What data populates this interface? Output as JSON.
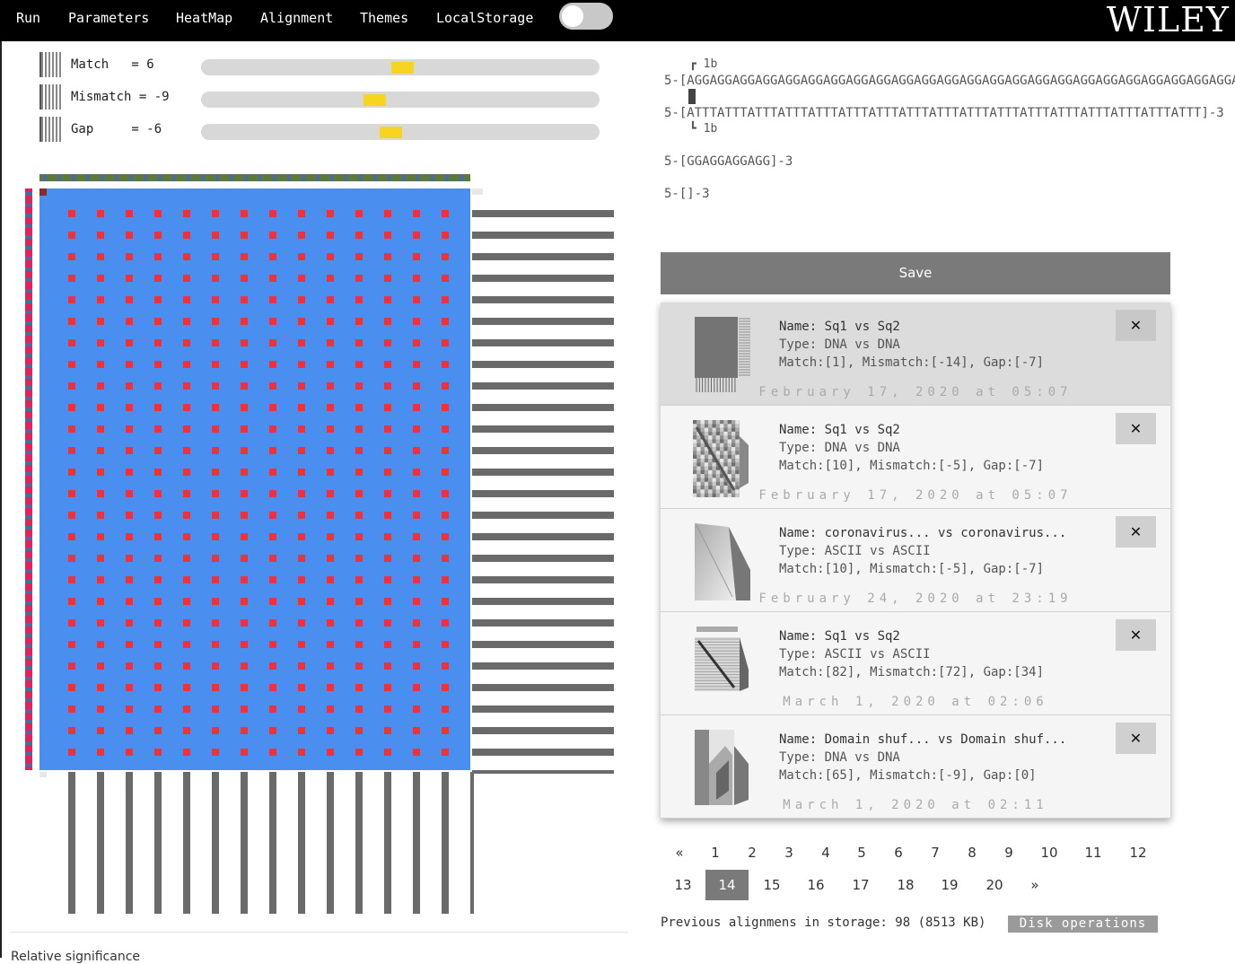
{
  "nav": {
    "items": [
      "Run",
      "Parameters",
      "HeatMap",
      "Alignment",
      "Themes",
      "LocalStorage"
    ],
    "toggle_on": false,
    "brand": "WILEY"
  },
  "parameters": [
    {
      "name": "Match",
      "text": "Match   = 6",
      "value": 6,
      "slider_fraction": 0.5
    },
    {
      "name": "Mismatch",
      "text": "Mismatch = -9",
      "value": -9,
      "slider_fraction": 0.43
    },
    {
      "name": "Gap",
      "text": "Gap     = -6",
      "value": -6,
      "slider_fraction": 0.47
    }
  ],
  "alignment": {
    "marker_top": "┏ 1b",
    "seq1": "5-[AGGAGGAGGAGGAGGAGGAGGAGGAGGAGGAGGAGGAGGAGGAGGAGGAGGAGGAGGAGGAGGAGGAGGAGGAGGA",
    "seq2": "5-[ATTTATTTATTTATTTATTTATTTATTTATTTATTTATTTATTTATTTATTTATTTATTTATTTATTT]-3",
    "marker_bottom": "┗ 1b",
    "seq3": "5-[GGAGGAGGAGG]-3",
    "seq4": "5-[]-3"
  },
  "heatmap": {
    "rows": 26,
    "cols": 14,
    "background": "#4a8ef0",
    "dot_color": "#f0303a",
    "top_bar_color": "#5c7a3c",
    "left_bar_color": "#e0245a",
    "bar_color": "#6a6a6a"
  },
  "save_label": "Save",
  "saved_alignments": [
    {
      "name": "Name: Sq1 vs Sq2",
      "type": "Type: DNA vs DNA",
      "params": "Match:[1], Mismatch:[-14], Gap:[-7]",
      "date": "February 17, 2020 at 05:07",
      "active": true,
      "thumb": "dense"
    },
    {
      "name": "Name: Sq1 vs Sq2",
      "type": "Type: DNA vs DNA",
      "params": "Match:[10], Mismatch:[-5], Gap:[-7]",
      "date": "February 17, 2020 at 05:07",
      "active": false,
      "thumb": "checker"
    },
    {
      "name": "Name: coronavirus... vs coronavirus...",
      "type": "Type: ASCII vs ASCII",
      "params": "Match:[10], Mismatch:[-5], Gap:[-7]",
      "date": "February 24, 2020 at 23:19",
      "active": false,
      "thumb": "smooth"
    },
    {
      "name": "Name: Sq1 vs Sq2",
      "type": "Type: ASCII vs ASCII",
      "params": "Match:[82], Mismatch:[72], Gap:[34]",
      "date": "March 1, 2020 at 02:06",
      "active": false,
      "thumb": "diagonal"
    },
    {
      "name": "Name: Domain shuf... vs Domain shuf...",
      "type": "Type: DNA vs DNA",
      "params": "Match:[65], Mismatch:[-9], Gap:[0]",
      "date": "March 1, 2020 at 02:11",
      "active": false,
      "thumb": "blocks"
    }
  ],
  "close_label": "✕",
  "pagination": {
    "row1": [
      "«",
      "1",
      "2",
      "3",
      "4",
      "5",
      "6",
      "7",
      "8",
      "9",
      "10",
      "11",
      "12"
    ],
    "row2": [
      "13",
      "14",
      "15",
      "16",
      "17",
      "18",
      "19",
      "20",
      "»"
    ],
    "active": "14"
  },
  "storage": {
    "text": "Previous alignmens in storage: 98 (8513 KB)",
    "disk_button": "Disk operations"
  },
  "footer_text": "Relative significance"
}
